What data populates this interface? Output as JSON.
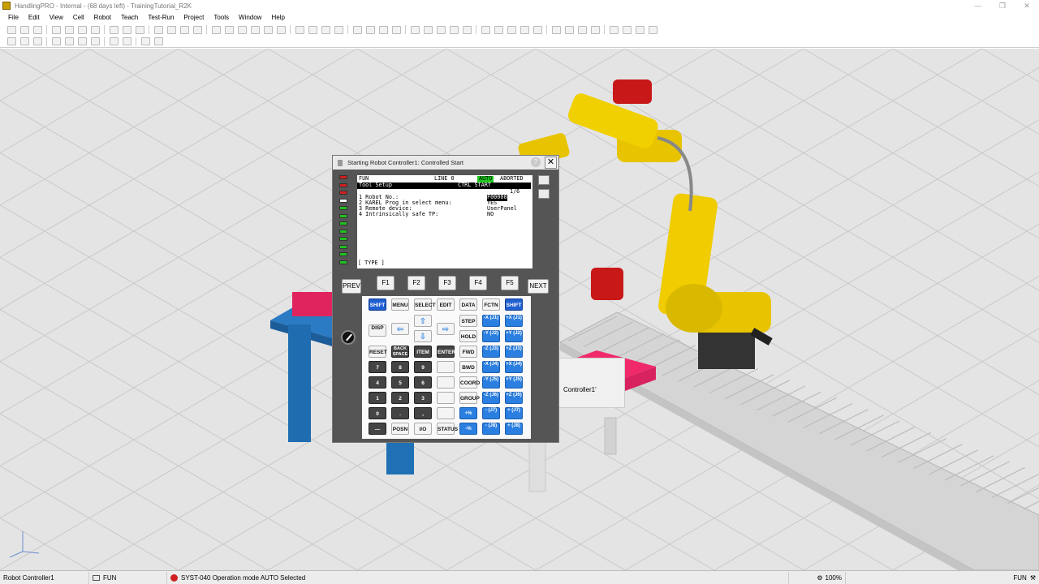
{
  "window": {
    "title": "HandlingPRO - Internal - (68 days left) - TrainingTutorial_R2K"
  },
  "menu": [
    "File",
    "Edit",
    "View",
    "Cell",
    "Robot",
    "Teach",
    "Test-Run",
    "Project",
    "Tools",
    "Window",
    "Help"
  ],
  "dialog": {
    "title": "Starting Robot Controller1: Controlled Start",
    "lcd": {
      "header_left": "FUN",
      "header_line": "LINE 0",
      "header_mode": "AUTO",
      "header_status": "ABORTED",
      "title_left": "Tool Setup",
      "title_right": "CTRL START",
      "page": "1/6",
      "items": [
        {
          "label": "1 Robot No.:",
          "value": "F00000"
        },
        {
          "label": "2 KAREL Prog in select menu:",
          "value": "YES"
        },
        {
          "label": "3 Remote device:",
          "value": "UserPanel"
        },
        {
          "label": "4 Intrinsically safe TP:",
          "value": "NO"
        }
      ],
      "footer": "[ TYPE ]"
    },
    "fkeys": [
      "PREV",
      "F1",
      "F2",
      "F3",
      "F4",
      "F5",
      "NEXT"
    ],
    "keys": {
      "shift": "SHIFT",
      "menu": "MENU",
      "select": "SELECT",
      "edit": "EDIT",
      "data": "DATA",
      "fctn": "FCTN",
      "disp": "DISP",
      "step": "STEP",
      "hold": "HOLD",
      "reset": "RESET",
      "backspace": "BACK SPACE",
      "item": "ITEM",
      "enter": "ENTER",
      "fwd": "FWD",
      "bwd": "BWD",
      "coord": "COORD",
      "group": "GROUP",
      "posn": "POSN",
      "io": "I/O",
      "status": "STATUS",
      "minus": "—",
      "digits": [
        "7",
        "8",
        "9",
        "4",
        "5",
        "6",
        "1",
        "2",
        "3",
        "0",
        ".",
        ","
      ]
    },
    "jog": [
      {
        "neg": "-X (J1)",
        "pos": "+X (J1)"
      },
      {
        "neg": "-Y (J2)",
        "pos": "+Y (J2)"
      },
      {
        "neg": "-Z (J3)",
        "pos": "+Z (J3)"
      },
      {
        "neg": "-X (J4)",
        "pos": "+X (J4)"
      },
      {
        "neg": "-Y (J5)",
        "pos": "+Y (J5)"
      },
      {
        "neg": "-Z (J6)",
        "pos": "+Z (J6)"
      },
      {
        "neg": "- (J7)",
        "pos": "+ (J7)"
      },
      {
        "neg": "- (J8)",
        "pos": "+ (J8)"
      }
    ],
    "speed": {
      "plus": "+%",
      "minus": "-%"
    }
  },
  "behind_dialog_text": "Controller1'",
  "status": {
    "controller": "Robot Controller1",
    "tp_mode": "FUN",
    "message": "SYST-040 Operation mode AUTO Selected",
    "zoom": "100%",
    "right_mode": "FUN"
  },
  "colors": {
    "robot": "#e8c400",
    "fixture": "#1f6db0",
    "part": "#e0245e",
    "jog_key": "#2a7fe0",
    "auto_ind": "#1ec81e"
  }
}
